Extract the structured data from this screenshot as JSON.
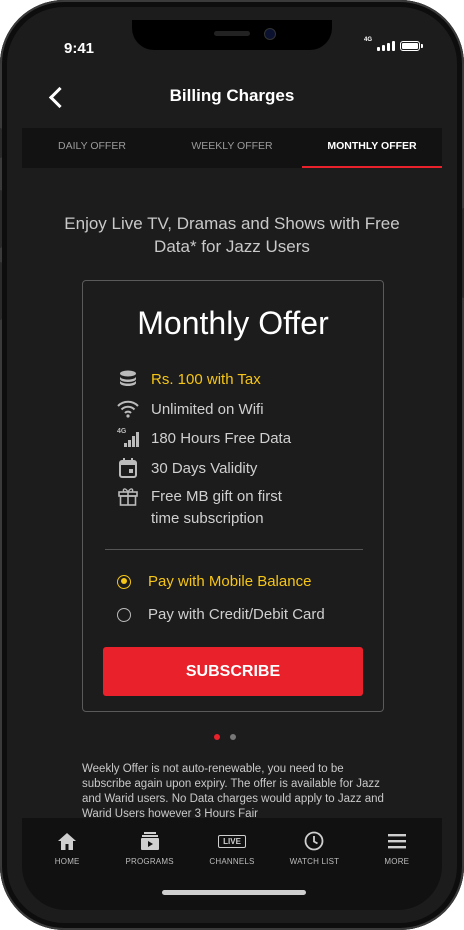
{
  "status": {
    "time": "9:41",
    "network": "4G"
  },
  "header": {
    "title": "Billing Charges"
  },
  "tabs": [
    {
      "label": "DAILY OFFER",
      "active": false
    },
    {
      "label": "WEEKLY OFFER",
      "active": false
    },
    {
      "label": "MONTHLY OFFER",
      "active": true
    }
  ],
  "tagline": "Enjoy Live TV, Dramas and Shows with Free Data* for Jazz Users",
  "offer": {
    "title": "Monthly Offer",
    "features": [
      {
        "icon": "coins-icon",
        "text": "Rs. 100 with Tax",
        "highlight": true
      },
      {
        "icon": "wifi-icon",
        "text": "Unlimited on Wifi"
      },
      {
        "icon": "4g-signal-icon",
        "text": "180 Hours Free Data",
        "icon_label": "4G"
      },
      {
        "icon": "calendar-icon",
        "text": "30 Days Validity"
      },
      {
        "icon": "gift-icon",
        "text": "Free MB gift on first time subscription"
      }
    ],
    "payment_options": [
      {
        "label": "Pay with Mobile Balance",
        "selected": true
      },
      {
        "label": "Pay with Credit/Debit Card",
        "selected": false
      }
    ],
    "subscribe_label": "SUBSCRIBE"
  },
  "pager": {
    "count": 2,
    "active": 1
  },
  "disclaimer": "Weekly Offer is not auto-renewable, you need to be subscribe again upon expiry. The offer is available for Jazz and Warid users. No Data charges would apply to Jazz and Warid Users however 3 Hours Fair",
  "nav": [
    {
      "label": "HOME",
      "icon": "home-icon"
    },
    {
      "label": "PROGRAMS",
      "icon": "programs-icon"
    },
    {
      "label": "CHANNELS",
      "icon": "live-channels-icon",
      "badge": "LIVE"
    },
    {
      "label": "WATCH LIST",
      "icon": "clock-icon"
    },
    {
      "label": "MORE",
      "icon": "menu-icon"
    }
  ],
  "colors": {
    "accent": "#e8212b",
    "highlight": "#f5c518",
    "background": "#1c1c1c"
  }
}
